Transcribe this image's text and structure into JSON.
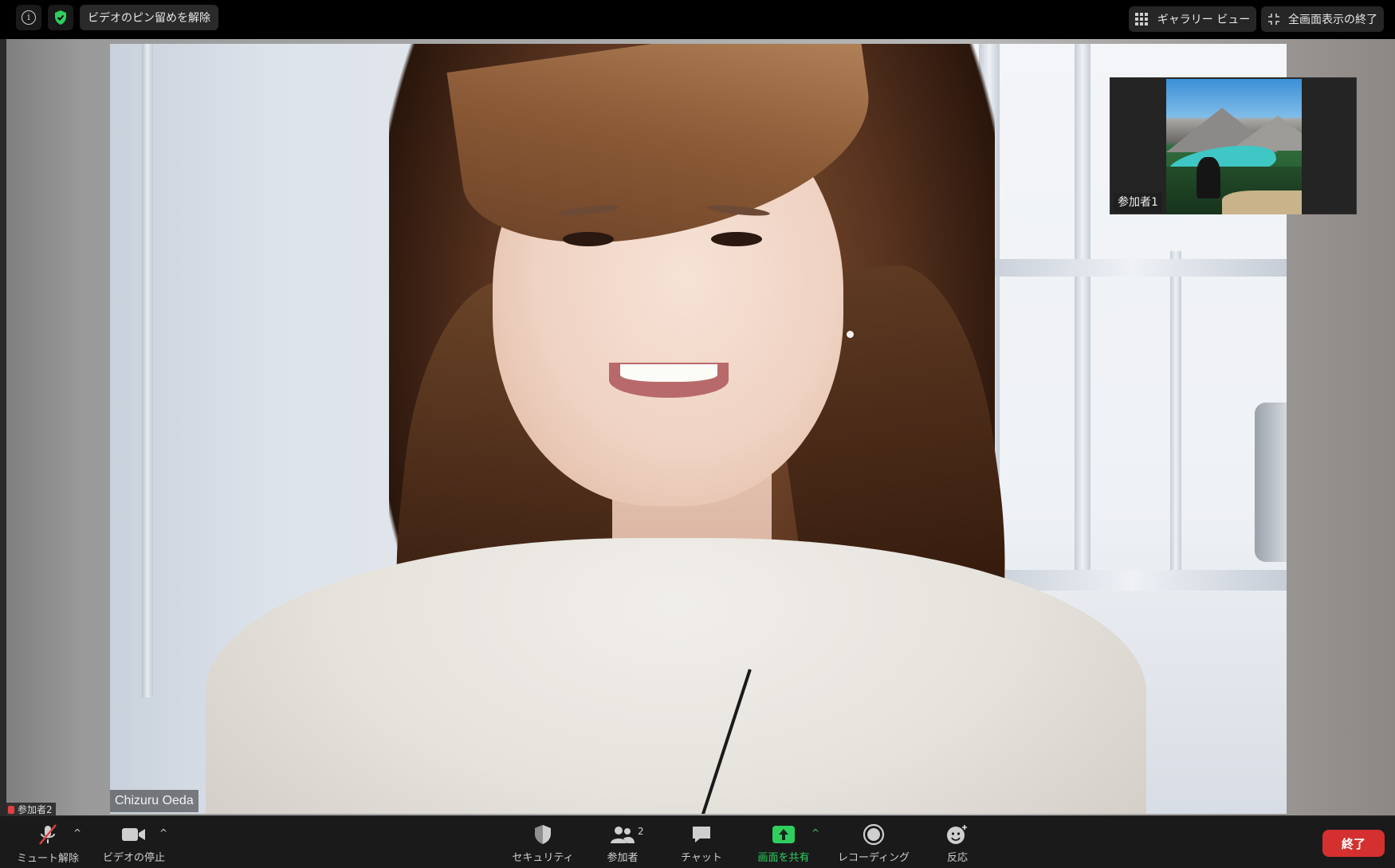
{
  "topbar": {
    "info_icon": "info-icon",
    "shield_icon": "shield-check-icon",
    "unpin_label": "ビデオのピン留めを解除",
    "gallery_label": "ギャラリー ビュー",
    "exit_fullscreen_label": "全画面表示の終了"
  },
  "main_video": {
    "name": "Chizuru Oeda"
  },
  "thumbnail": {
    "name": "参加者1"
  },
  "self_view": {
    "name": "参加者2"
  },
  "toolbar": {
    "unmute_label": "ミュート解除",
    "stop_video_label": "ビデオの停止",
    "security_label": "セキュリティ",
    "participants_label": "参加者",
    "participants_count": "2",
    "chat_label": "チャット",
    "share_label": "画面を共有",
    "record_label": "レコーディング",
    "reactions_label": "反応",
    "end_label": "終了"
  },
  "colors": {
    "end_button": "#d3302f",
    "share_accent": "#2fce5f",
    "shield_accent": "#2fce5f"
  }
}
